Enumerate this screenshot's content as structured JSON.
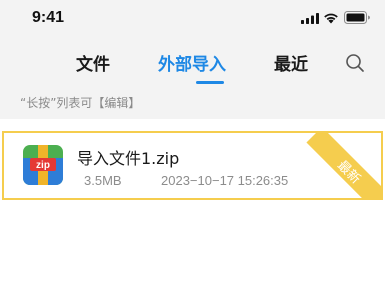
{
  "status_bar": {
    "time": "9:41"
  },
  "tabs": [
    {
      "label": "文件"
    },
    {
      "label": "外部导入",
      "active": true
    },
    {
      "label": "最近"
    }
  ],
  "hint": "“长按”列表可【编辑】",
  "file": {
    "name": "导入文件1.zip",
    "icon_label": "zip",
    "size": "3.5MB",
    "date": "2023−10−17 15:26:35",
    "badge": "最新"
  },
  "colors": {
    "accent": "#1e88e5",
    "highlight": "#f5cd4e",
    "muted_text": "#8c8c8c"
  }
}
